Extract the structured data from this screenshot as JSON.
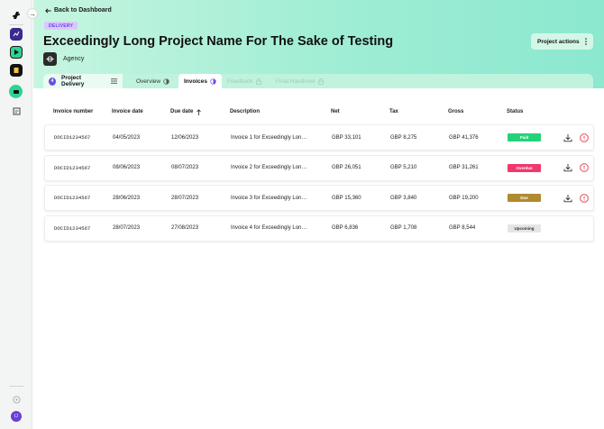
{
  "nav": {
    "back_label": "Back to Dashboard",
    "collapse_glyph": "→"
  },
  "project": {
    "stage_badge": "DELIVERY",
    "title": "Exceedingly Long Project Name For The Sake of Testing",
    "agency_name": "Agency",
    "actions_label": "Project actions"
  },
  "tabs": {
    "step_number": "4",
    "phase_label": "Project Delivery",
    "items": [
      {
        "label": "Overview",
        "state": "enabled"
      },
      {
        "label": "Invoices",
        "state": "active"
      },
      {
        "label": "Feedback",
        "state": "disabled"
      },
      {
        "label": "Final Handover",
        "state": "disabled"
      }
    ]
  },
  "table": {
    "columns": [
      "Invoice number",
      "Invoice date",
      "Due date",
      "Description",
      "Net",
      "Tax",
      "Gross",
      "Status"
    ],
    "rows": [
      {
        "number": "DOCID1234567",
        "invoice_date": "04/05/2023",
        "due_date": "12/06/2023",
        "description": "Invoice 1 for Exceedingly Lon…",
        "net": "GBP 33,101",
        "tax": "GBP 8,275",
        "gross": "GBP 41,376",
        "status": "Paid",
        "status_color": "#22d37a",
        "status_text_color": "#ffffff",
        "actions": true
      },
      {
        "number": "DOCID1234567",
        "invoice_date": "08/06/2023",
        "due_date": "08/07/2023",
        "description": "Invoice 2 for Exceedingly Lon…",
        "net": "GBP 26,051",
        "tax": "GBP 5,210",
        "gross": "GBP 31,261",
        "status": "Overdue",
        "status_color": "#f0386b",
        "status_text_color": "#ffffff",
        "actions": true
      },
      {
        "number": "DOCID1234567",
        "invoice_date": "28/06/2023",
        "due_date": "28/07/2023",
        "description": "Invoice 3 for Exceedingly Lon…",
        "net": "GBP 15,360",
        "tax": "GBP 3,840",
        "gross": "GBP 19,200",
        "status": "Due",
        "status_color": "#b08a2e",
        "status_text_color": "#ffffff",
        "actions": true
      },
      {
        "number": "DOCID1234567",
        "invoice_date": "28/07/2023",
        "due_date": "27/08/2023",
        "description": "Invoice 4 for Exceedingly Lon…",
        "net": "GBP 6,836",
        "tax": "GBP 1,708",
        "gross": "GBP 8,544",
        "status": "Upcoming",
        "status_color": "#e4e6e5",
        "status_text_color": "#333333",
        "actions": false
      }
    ]
  },
  "user": {
    "avatar_initials": "IJ"
  }
}
